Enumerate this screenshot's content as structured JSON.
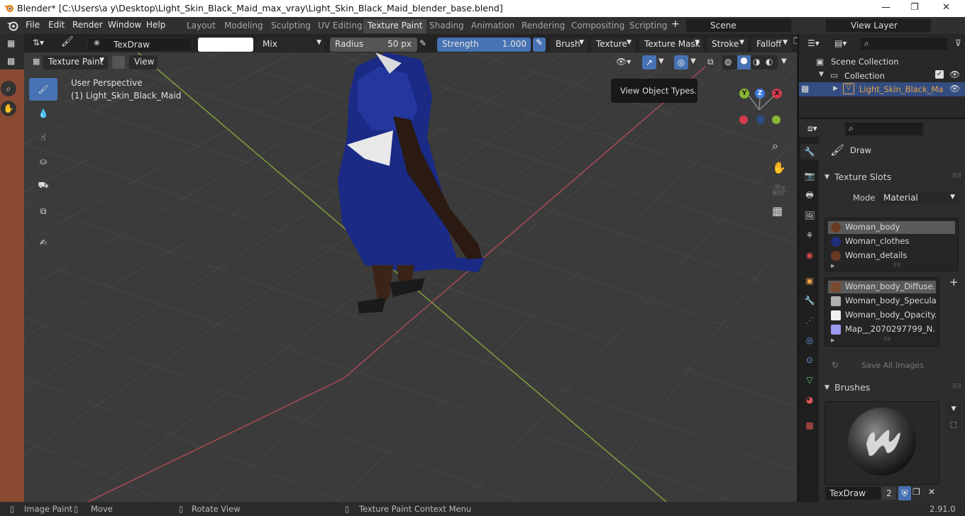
{
  "window": {
    "title": "Blender* [C:\\Users\\a y\\Desktop\\Light_Skin_Black_Maid_max_vray\\Light_Skin_Black_Maid_blender_base.blend]",
    "minimize": "—",
    "maximize": "❐",
    "close": "✕"
  },
  "menu": [
    "File",
    "Edit",
    "Render",
    "Window",
    "Help"
  ],
  "workspaces": [
    "Layout",
    "Modeling",
    "Sculpting",
    "UV Editing",
    "Texture Paint",
    "Shading",
    "Animation",
    "Rendering",
    "Compositing",
    "Scripting"
  ],
  "active_workspace": "Texture Paint",
  "scene": {
    "label": "Scene",
    "view_layer": "View Layer"
  },
  "tool_header": {
    "brush_name": "TexDraw",
    "blend_mode": "Mix",
    "radius_label": "Radius",
    "radius_value": "50 px",
    "strength_label": "Strength",
    "strength_value": "1.000",
    "dropdowns": [
      "Brush",
      "Texture",
      "Texture Mask",
      "Stroke",
      "Falloff"
    ]
  },
  "viewport_header": {
    "mode": "Texture Paint",
    "view": "View"
  },
  "viewport": {
    "perspective": "User Perspective",
    "object": "(1) Light_Skin_Black_Maid",
    "tooltip": "View Object Types.",
    "axes": {
      "x": "X",
      "y": "Y",
      "z": "Z"
    }
  },
  "outliner": {
    "scene_collection": "Scene Collection",
    "collection": "Collection",
    "object": "Light_Skin_Black_Ma"
  },
  "properties": {
    "tool_name": "Draw",
    "texture_slots_title": "Texture Slots",
    "mode_label": "Mode",
    "mode_value": "Material",
    "materials": [
      {
        "name": "Woman_body",
        "color": "#6b3a22"
      },
      {
        "name": "Woman_clothes",
        "color": "#1f2e78"
      },
      {
        "name": "Woman_details",
        "color": "#6b3a22"
      }
    ],
    "textures": [
      {
        "name": "Woman_body_Diffuse.p...",
        "color": "#7a4a30"
      },
      {
        "name": "Woman_body_Specular...",
        "color": "#b0b0b0"
      },
      {
        "name": "Woman_body_Opacity....",
        "color": "#f0f0f0"
      },
      {
        "name": "Map__2070297799_N...",
        "color": "#9b9bf0"
      }
    ],
    "save_all": "Save All Images",
    "brushes_title": "Brushes",
    "brush_name": "TexDraw",
    "brush_users": "2"
  },
  "statusbar": {
    "items": [
      "Image Paint",
      "Move",
      "Rotate View",
      "Texture Paint Context Menu"
    ],
    "version": "2.91.0"
  },
  "colors": {
    "accent": "#4772b3",
    "x_axis": "#d43c4c",
    "y_axis": "#8ab535",
    "z_axis": "#3a78e0"
  }
}
